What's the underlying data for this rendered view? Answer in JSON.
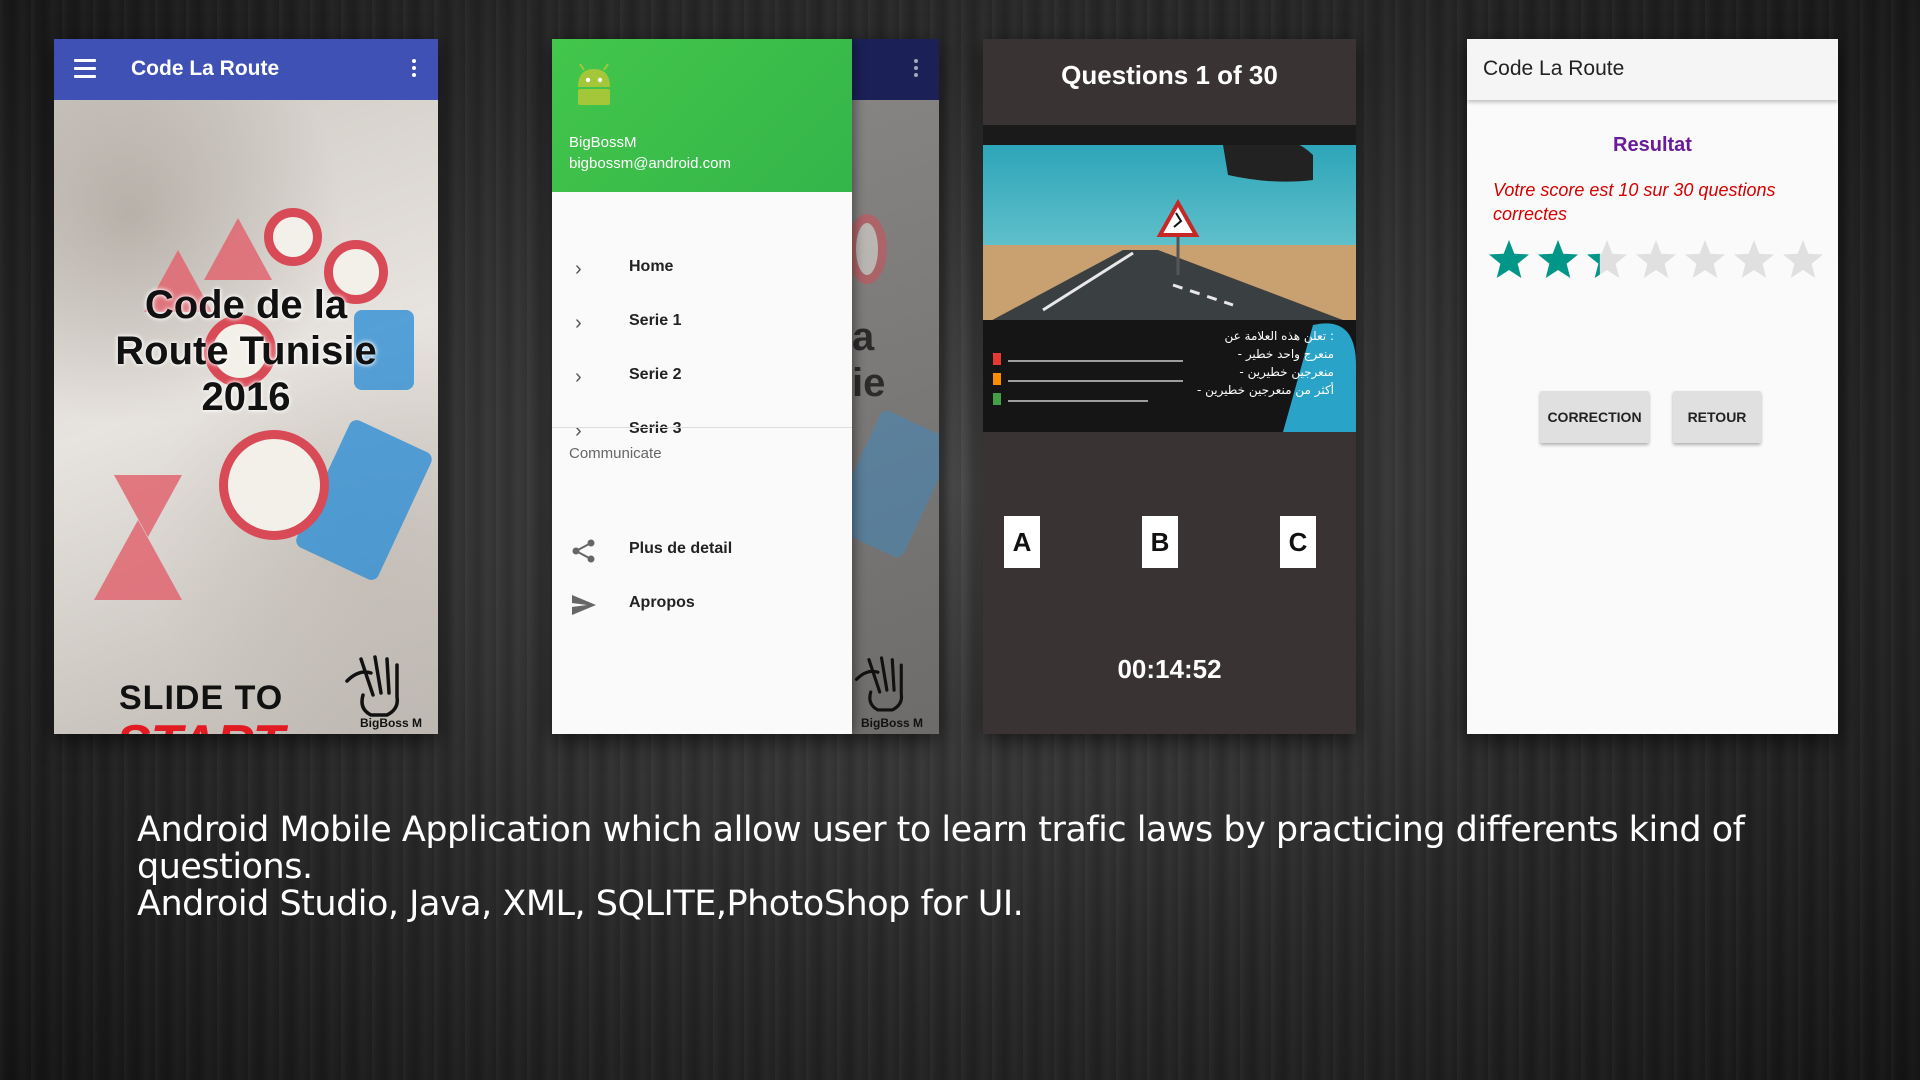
{
  "screen1": {
    "app_title": "Code La Route",
    "splash_title": "Code de la Route Tunisie 2016",
    "slide_line1": "SLIDE TO",
    "slide_line2": "START.",
    "signature": "BigBoss M"
  },
  "screen2": {
    "user_name": "BigBossM",
    "user_email": "bigbossm@android.com",
    "menu_items": [
      {
        "label": "Home"
      },
      {
        "label": "Serie 1"
      },
      {
        "label": "Serie 2"
      },
      {
        "label": "Serie 3"
      }
    ],
    "section_label": "Communicate",
    "communicate_items": [
      {
        "label": "Plus de detail",
        "icon": "share-icon"
      },
      {
        "label": "Apropos",
        "icon": "send-icon"
      }
    ],
    "background_fragment": "a ie",
    "signature": "BigBoss M"
  },
  "screen3": {
    "question_title": "Questions 1 of 30",
    "photo_text": [
      "تعلن هذه العلامة عن :",
      "- منعرج واحد خطير",
      "- منعرجين خطيرين",
      "- أكثر من منعرجين خطيرين"
    ],
    "options": [
      "A",
      "B",
      "C"
    ],
    "timer": "00:14:52"
  },
  "screen4": {
    "app_title": "Code La Route",
    "result_title": "Resultat",
    "score_text": "Votre score est 10 sur 30 questions correctes",
    "rating": {
      "value": 2.33,
      "max": 7
    },
    "correction_button": "CORRECTION",
    "retour_button": "RETOUR"
  },
  "caption": {
    "line1": "Android Mobile Application which allow user to learn trafic laws by practicing differents kind of questions.",
    "line2": "Android Studio, Java, XML, SQLITE,PhotoShop for UI."
  },
  "colors": {
    "primary": "#3f51b5",
    "drawer_header": "#43c64b",
    "star_filled": "#009688",
    "score_red": "#d50000",
    "result_purple": "#6a1b9a"
  }
}
